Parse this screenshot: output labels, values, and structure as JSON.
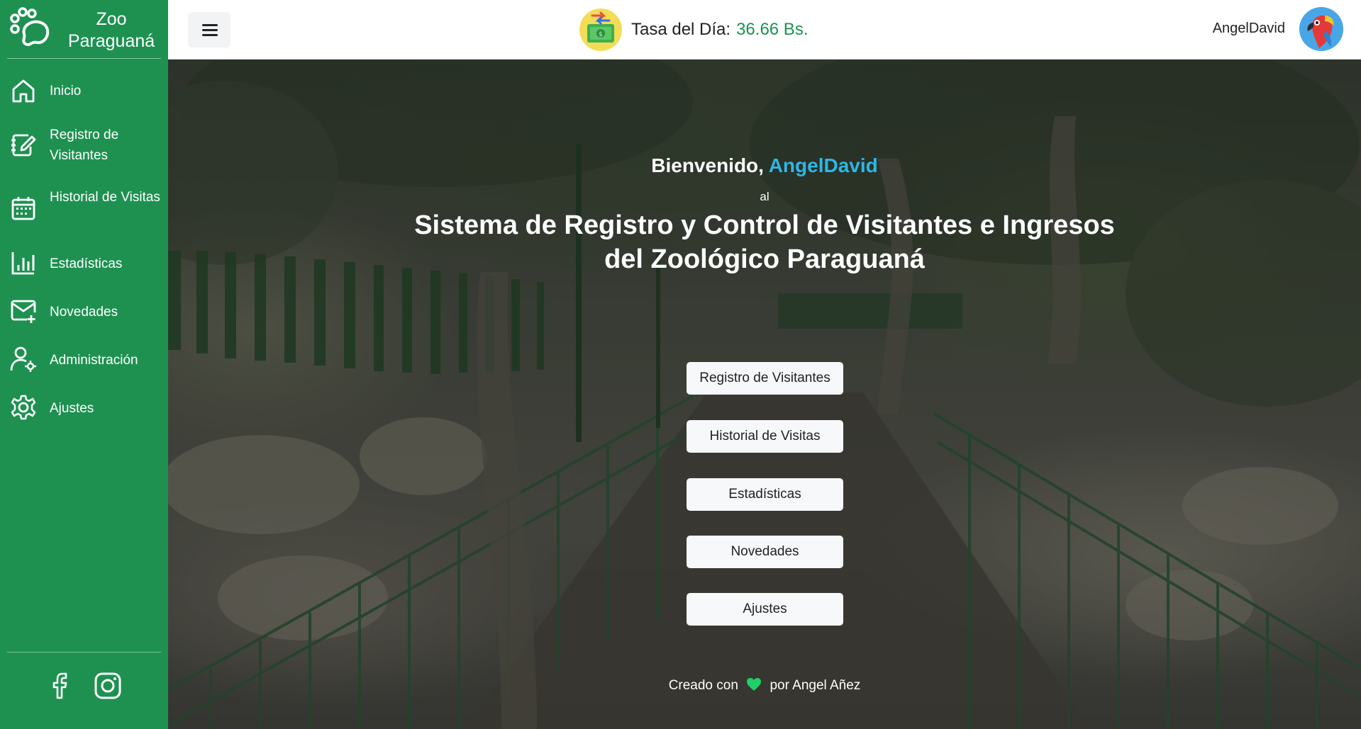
{
  "brand": {
    "line1": "Zoo",
    "line2": "Paraguaná"
  },
  "sidebar": {
    "items": [
      {
        "label": "Inicio",
        "icon": "home-icon"
      },
      {
        "label": "Registro de Visitantes",
        "icon": "edit-document-icon"
      },
      {
        "label": "Historial de Visitas",
        "icon": "calendar-icon"
      },
      {
        "label": "Estadísticas",
        "icon": "bar-chart-icon"
      },
      {
        "label": "Novedades",
        "icon": "mail-plus-icon"
      },
      {
        "label": "Administración",
        "icon": "user-gear-icon"
      },
      {
        "label": "Ajustes",
        "icon": "gear-icon"
      }
    ],
    "social": [
      "facebook-icon",
      "instagram-icon"
    ]
  },
  "header": {
    "rate_label": "Tasa del Día:",
    "rate_value": "36.66 Bs.",
    "username": "AngelDavid"
  },
  "hero": {
    "welcome_prefix": "Bienvenido,",
    "welcome_user": "AngelDavid",
    "al": "al",
    "title_line1": "Sistema de Registro y Control de Visitantes e Ingresos",
    "title_line2": "del Zoológico Paraguaná",
    "buttons": [
      "Registro de Visitantes",
      "Historial de Visitas",
      "Estadísticas",
      "Novedades",
      "Ajustes"
    ],
    "footer_prefix": "Creado con",
    "footer_suffix": "por Angel Añez"
  },
  "colors": {
    "sidebar": "#1e9151",
    "accent_user": "#2fb6e6",
    "rate_value": "#1e9151",
    "heart": "#1fcf6a"
  }
}
